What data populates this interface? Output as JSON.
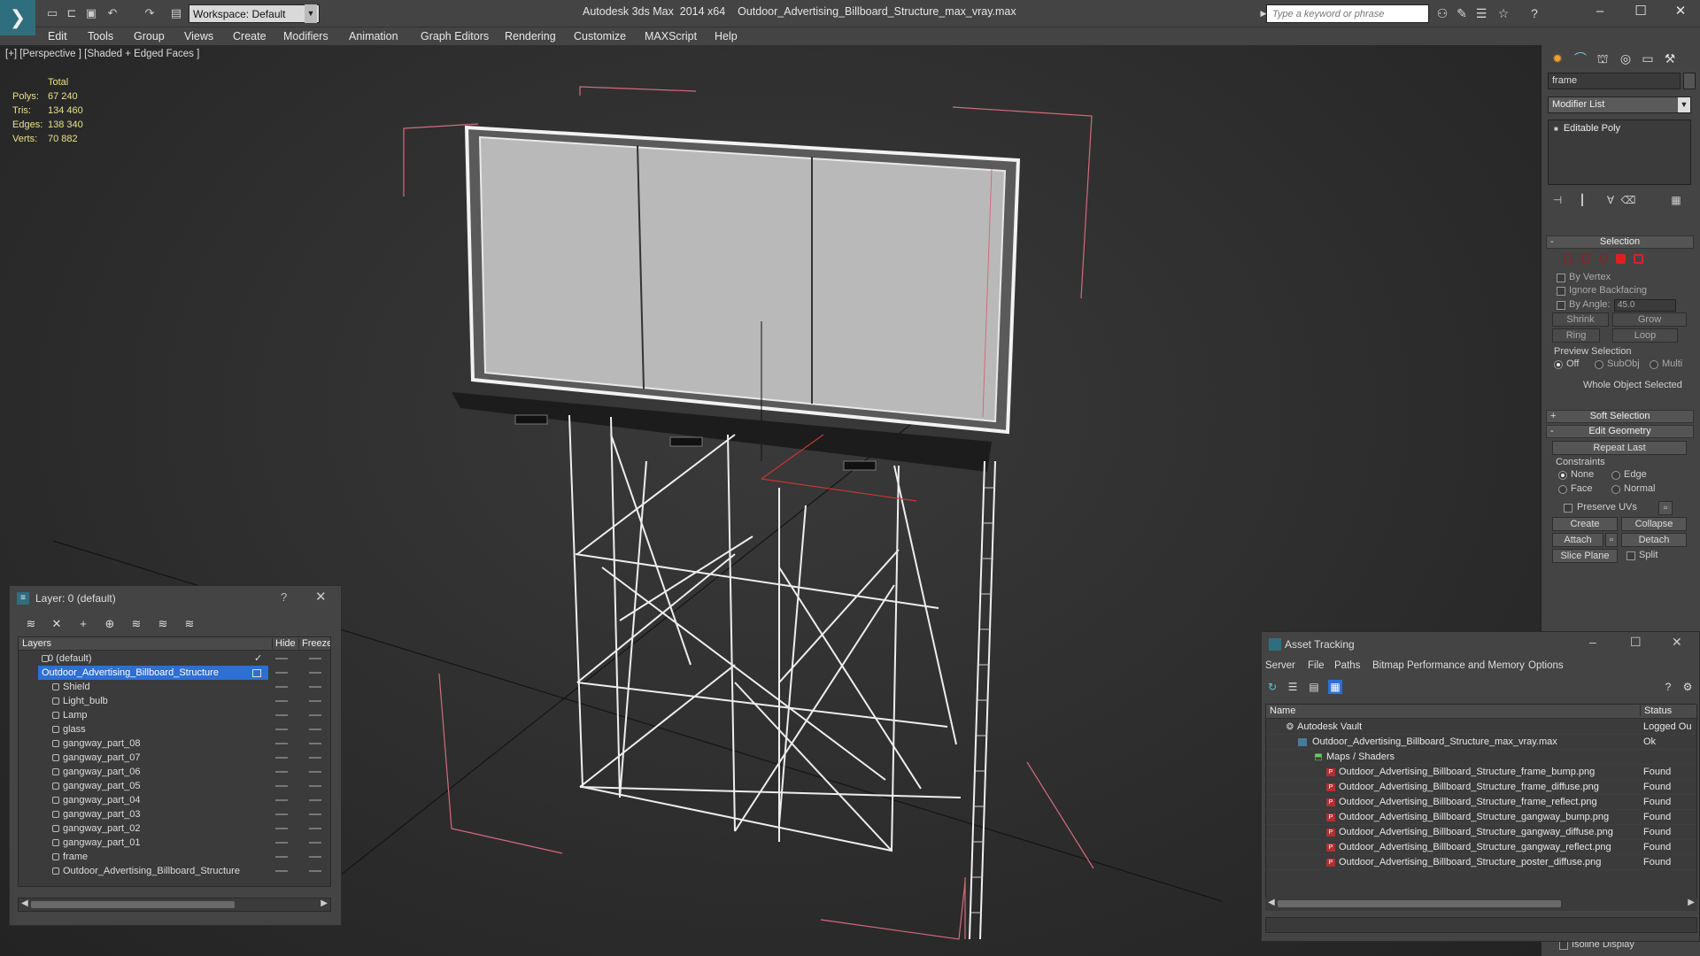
{
  "window": {
    "app_title": "Autodesk 3ds Max  2014 x64",
    "file_title": "Outdoor_Advertising_Billboard_Structure_max_vray.max",
    "workspace": "Workspace: Default",
    "search_placeholder": "Type a keyword or phrase"
  },
  "menu": [
    "Edit",
    "Tools",
    "Group",
    "Views",
    "Create",
    "Modifiers",
    "Animation",
    "Graph Editors",
    "Rendering",
    "Customize",
    "MAXScript",
    "Help"
  ],
  "viewport": {
    "label": "[+] [Perspective ] [Shaded + Edged Faces ]",
    "stats_header": "Total",
    "stats": [
      {
        "key": "Polys:",
        "value": "67 240"
      },
      {
        "key": "Tris:",
        "value": "134 460"
      },
      {
        "key": "Edges:",
        "value": "138 340"
      },
      {
        "key": "Verts:",
        "value": "70 882"
      }
    ]
  },
  "command_panel": {
    "object_name": "frame",
    "modifier_list": "Modifier List",
    "stack_item": "Editable Poly",
    "selection_title": "Selection",
    "by_vertex": "By Vertex",
    "ignore_backfacing": "Ignore Backfacing",
    "by_angle": "By Angle:",
    "angle_value": "45.0",
    "shrink": "Shrink",
    "grow": "Grow",
    "ring": "Ring",
    "loop": "Loop",
    "preview_selection": "Preview Selection",
    "off": "Off",
    "subobj": "SubObj",
    "multi": "Multi",
    "whole_object": "Whole Object Selected",
    "soft_selection": "Soft Selection",
    "edit_geometry": "Edit Geometry",
    "repeat_last": "Repeat Last",
    "constraints": "Constraints",
    "none": "None",
    "edge": "Edge",
    "face": "Face",
    "normal": "Normal",
    "preserve_uvs": "Preserve UVs",
    "create": "Create",
    "collapse": "Collapse",
    "attach": "Attach",
    "detach": "Detach",
    "slice_plane": "Slice Plane",
    "split": "Split",
    "isoline": "Isoline Display"
  },
  "layer_window": {
    "title": "Layer: 0 (default)",
    "help": "?",
    "col_layers": "Layers",
    "col_hide": "Hide",
    "col_freeze": "Freeze",
    "rows": [
      {
        "name": "0 (default)",
        "level": 0
      },
      {
        "name": "Outdoor_Advertising_Billboard_Structure",
        "level": 0,
        "selected": true
      },
      {
        "name": "Shield",
        "level": 1
      },
      {
        "name": "Light_bulb",
        "level": 1
      },
      {
        "name": "Lamp",
        "level": 1
      },
      {
        "name": "glass",
        "level": 1
      },
      {
        "name": "gangway_part_08",
        "level": 1
      },
      {
        "name": "gangway_part_07",
        "level": 1
      },
      {
        "name": "gangway_part_06",
        "level": 1
      },
      {
        "name": "gangway_part_05",
        "level": 1
      },
      {
        "name": "gangway_part_04",
        "level": 1
      },
      {
        "name": "gangway_part_03",
        "level": 1
      },
      {
        "name": "gangway_part_02",
        "level": 1
      },
      {
        "name": "gangway_part_01",
        "level": 1
      },
      {
        "name": "frame",
        "level": 1
      },
      {
        "name": "Outdoor_Advertising_Billboard_Structure",
        "level": 1
      }
    ]
  },
  "asset_window": {
    "title": "Asset Tracking",
    "menu": [
      "Server",
      "File",
      "Paths",
      "Bitmap Performance and Memory",
      "Options"
    ],
    "col_name": "Name",
    "col_status": "Status",
    "rows": [
      {
        "name": "Autodesk Vault",
        "status": "Logged Ou",
        "indent": 0
      },
      {
        "name": "Outdoor_Advertising_Billboard_Structure_max_vray.max",
        "status": "Ok",
        "indent": 1
      },
      {
        "name": "Maps / Shaders",
        "status": "",
        "indent": 2
      },
      {
        "name": "Outdoor_Advertising_Billboard_Structure_frame_bump.png",
        "status": "Found",
        "indent": 3
      },
      {
        "name": "Outdoor_Advertising_Billboard_Structure_frame_diffuse.png",
        "status": "Found",
        "indent": 3
      },
      {
        "name": "Outdoor_Advertising_Billboard_Structure_frame_reflect.png",
        "status": "Found",
        "indent": 3
      },
      {
        "name": "Outdoor_Advertising_Billboard_Structure_gangway_bump.png",
        "status": "Found",
        "indent": 3
      },
      {
        "name": "Outdoor_Advertising_Billboard_Structure_gangway_diffuse.png",
        "status": "Found",
        "indent": 3
      },
      {
        "name": "Outdoor_Advertising_Billboard_Structure_gangway_reflect.png",
        "status": "Found",
        "indent": 3
      },
      {
        "name": "Outdoor_Advertising_Billboard_Structure_poster_diffuse.png",
        "status": "Found",
        "indent": 3
      }
    ]
  },
  "colors": {
    "accent": "#2d6fd3",
    "stats": "#e8e08a",
    "selection_red": "#cc3333",
    "bounding_box": "#d46a7e"
  }
}
